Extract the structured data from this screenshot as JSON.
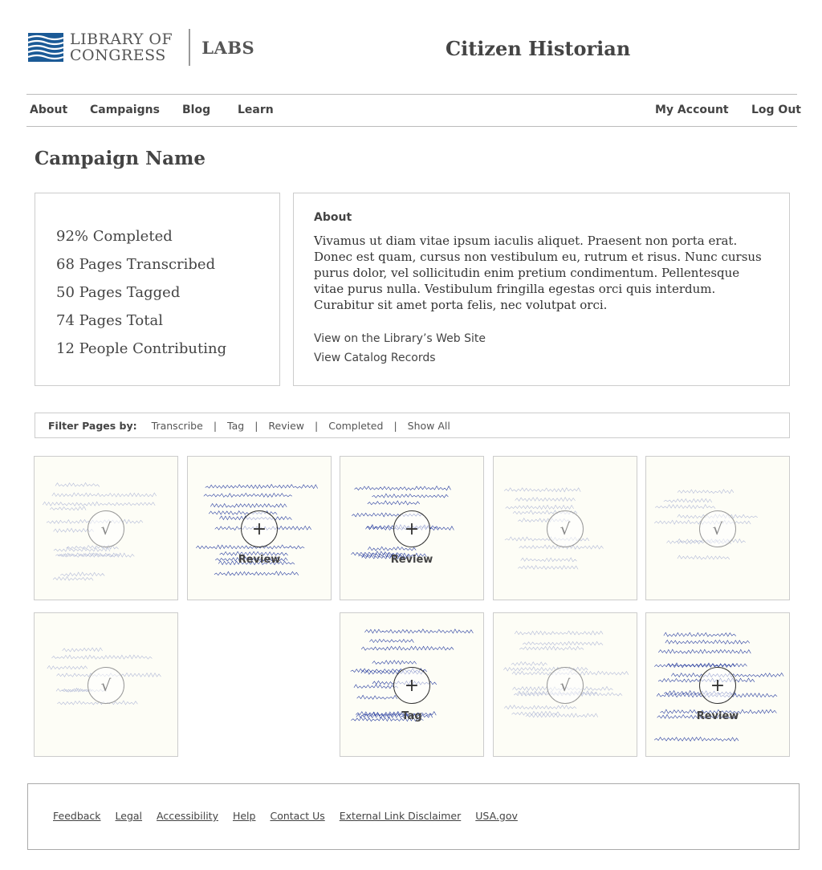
{
  "header": {
    "logo": {
      "line1": "LIBRARY OF",
      "line2": "CONGRESS",
      "labs": "LABS"
    },
    "site_title": "Citizen Historian"
  },
  "nav": {
    "left": [
      "About",
      "Campaigns",
      "Blog",
      "Learn"
    ],
    "right": [
      "My Account",
      "Log Out"
    ]
  },
  "campaign": {
    "name": "Campaign Name",
    "stats": [
      "92% Completed",
      "68 Pages Transcribed",
      "50 Pages Tagged",
      "74 Pages Total",
      "12 People Contributing"
    ],
    "about": {
      "title": "About",
      "text": "Vivamus ut diam vitae ipsum iaculis aliquet. Praesent non porta erat. Donec est quam, cursus non vestibulum eu, rutrum et risus. Nunc cursus purus dolor, vel sollicitudin enim pretium condimentum. Pellentesque vitae purus nulla. Vestibulum fringilla egestas orci quis interdum. Curabitur sit amet porta felis, nec volutpat orci.",
      "links": [
        "View on the Library’s Web Site",
        "View Catalog Records"
      ]
    }
  },
  "filter": {
    "label": "Filter Pages by:",
    "options": [
      "Transcribe",
      "Tag",
      "Review",
      "Completed",
      "Show All"
    ],
    "separator": "|"
  },
  "pages": [
    {
      "status": "completed",
      "icon": "checkmark-icon",
      "symbol": "√",
      "label": ""
    },
    {
      "status": "action",
      "icon": "plus-icon",
      "symbol": "+",
      "label": "Review"
    },
    {
      "status": "action",
      "icon": "plus-icon",
      "symbol": "+",
      "label": "Review"
    },
    {
      "status": "completed",
      "icon": "checkmark-icon",
      "symbol": "√",
      "label": ""
    },
    {
      "status": "completed",
      "icon": "checkmark-icon",
      "symbol": "√",
      "label": ""
    },
    {
      "status": "completed",
      "icon": "checkmark-icon",
      "symbol": "√",
      "label": ""
    },
    {
      "status": "action",
      "icon": "plus-icon",
      "symbol": "+",
      "label": "Tag"
    },
    {
      "status": "completed",
      "icon": "checkmark-icon",
      "symbol": "√",
      "label": ""
    },
    {
      "status": "action",
      "icon": "plus-icon",
      "symbol": "+",
      "label": "Review"
    }
  ],
  "footer": {
    "links": [
      "Feedback",
      "Legal",
      "Accessibility",
      "Help",
      "Contact Us",
      "External Link Disclaimer",
      "USA.gov"
    ]
  },
  "colors": {
    "flag_blue": "#1b5a96",
    "ink_blue": "#2a3fa0",
    "border": "#cccccc",
    "text": "#444444"
  }
}
